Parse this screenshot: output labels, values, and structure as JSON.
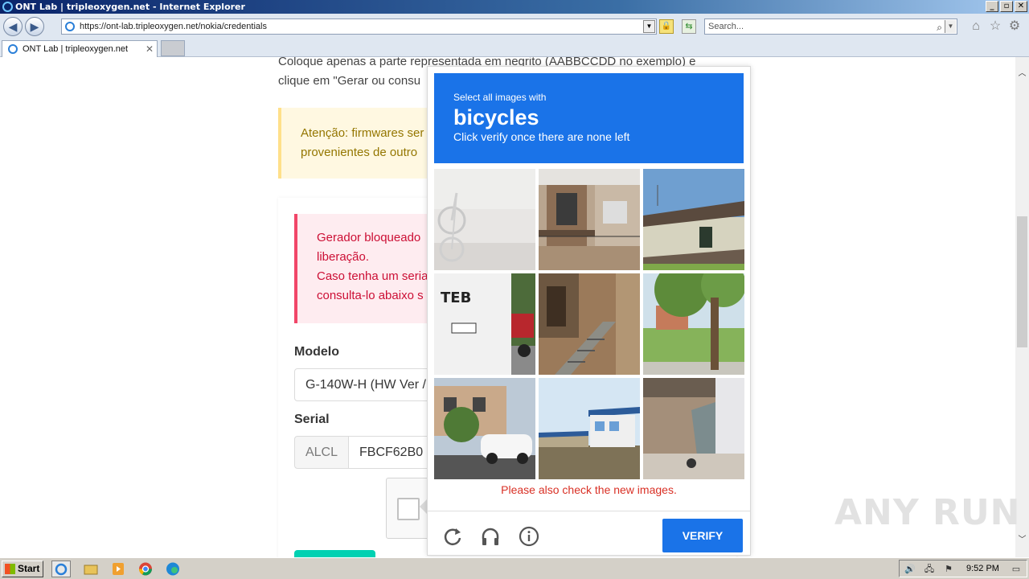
{
  "window": {
    "title": "ONT Lab | tripleoxygen.net - Internet Explorer",
    "controls": [
      "_",
      "▫",
      "✕"
    ]
  },
  "address_bar": {
    "url": "https://ont-lab.tripleoxygen.net/nokia/credentials",
    "search_placeholder": "Search..."
  },
  "tabs": [
    {
      "label": "ONT Lab | tripleoxygen.net",
      "active": true
    }
  ],
  "page": {
    "intro_text": "Coloque apenas a parte representada em negrito (AABBCCDD no exemplo) e clique em \"Gerar ou consu",
    "warning_text": "Atenção: firmwares ser\nprovenientes de outro",
    "danger_lines": [
      "Gerador bloqueado",
      "liberação.",
      "Caso tenha um seria",
      "consulta-lo abaixo s"
    ],
    "model_label": "Modelo",
    "model_value": "G-140W-H (HW Ver /",
    "serial_label": "Serial",
    "serial_prefix": "ALCL",
    "serial_value": "FBCF62B0"
  },
  "challenge": {
    "instruction": "Select all images with",
    "object": "bicycles",
    "hint": "Click verify once there are none left",
    "tiles": [
      "bicycle-faded",
      "house-balcony",
      "house-roof",
      "bus-rear",
      "brick-stairs",
      "tree-lawn",
      "car-street",
      "building-blue-roof",
      "garage-shadow"
    ],
    "error": "Please also check the new images.",
    "verify_label": "VERIFY",
    "accent": "#1a73e8"
  },
  "watermark": "ANY RUN",
  "taskbar": {
    "start_label": "Start",
    "clock": "9:52 PM"
  }
}
